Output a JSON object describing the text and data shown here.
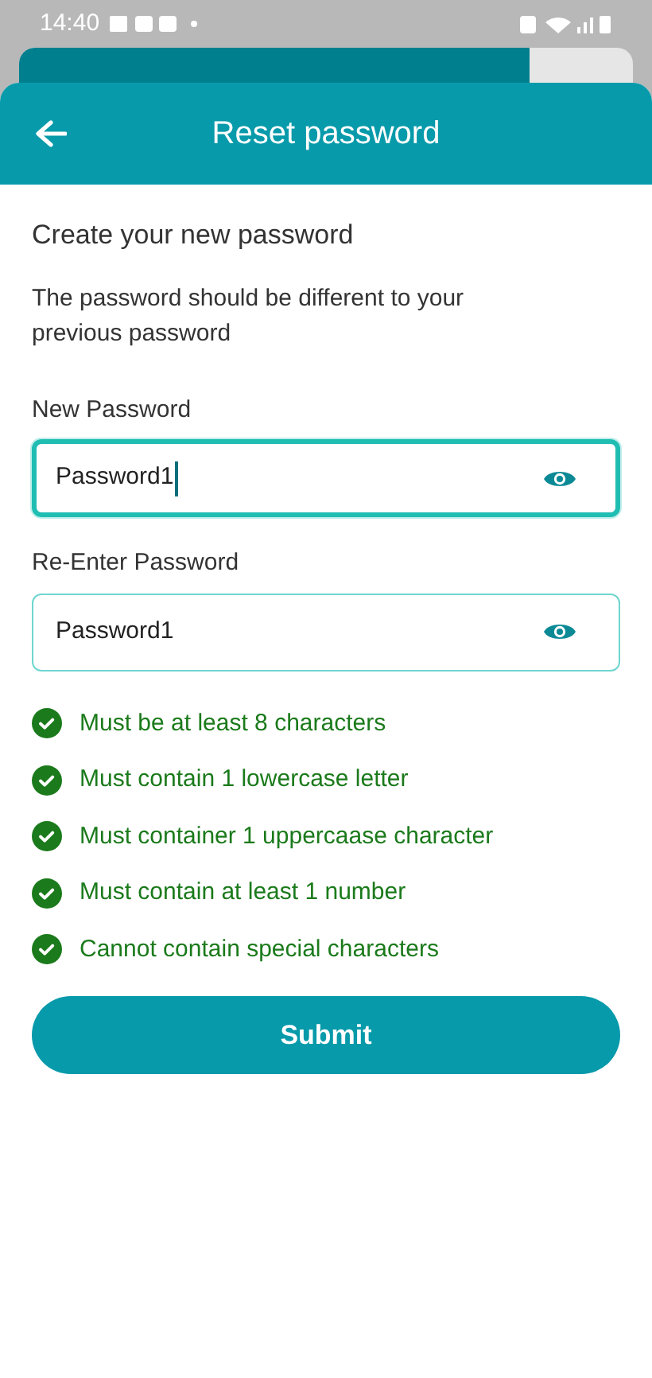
{
  "status_bar": {
    "time": "14:40"
  },
  "header": {
    "title": "Reset password"
  },
  "heading": "Create your new password",
  "description": "The password should be different to your previous password",
  "fields": [
    {
      "label": "New Password",
      "value": "Password1",
      "focused": true
    },
    {
      "label": "Re-Enter Password",
      "value": "Password1",
      "focused": false
    }
  ],
  "rules": [
    {
      "text": "Must be at least 8 characters",
      "met": true
    },
    {
      "text": "Must contain 1 lowercase letter",
      "met": true
    },
    {
      "text": "Must container 1 uppercaase character",
      "met": true
    },
    {
      "text": "Must contain at least 1 number",
      "met": true
    },
    {
      "text": "Cannot contain special characters",
      "met": true
    }
  ],
  "submit_button": "Submit"
}
